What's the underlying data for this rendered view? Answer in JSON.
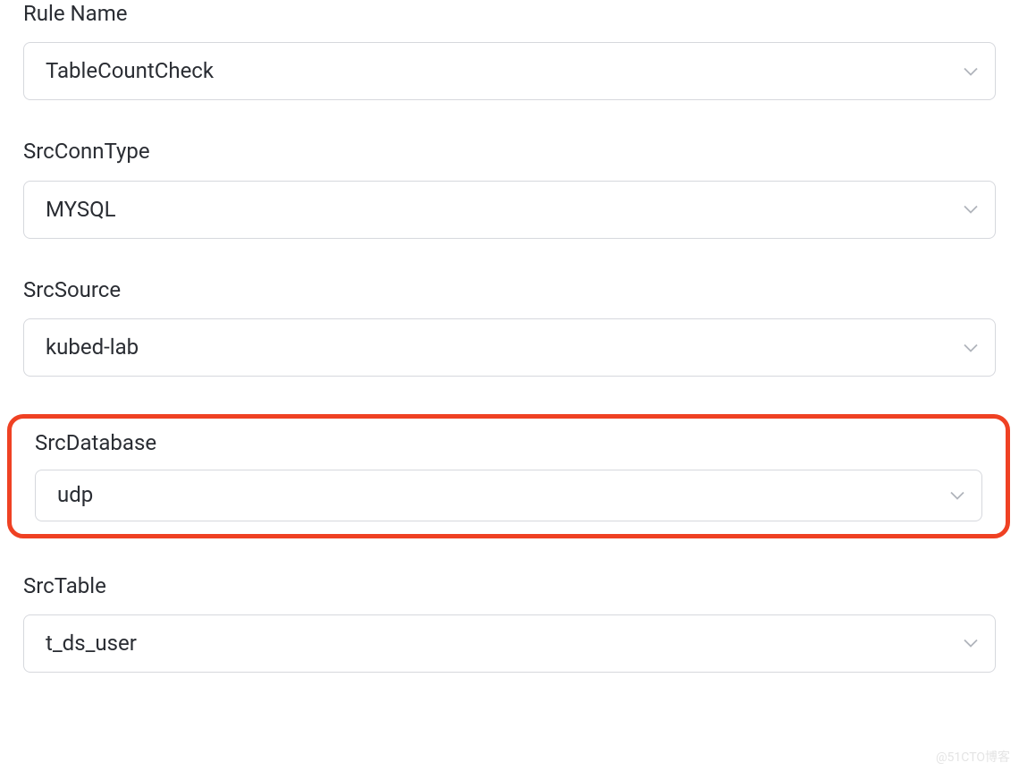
{
  "fields": {
    "ruleName": {
      "label": "Rule Name",
      "value": "TableCountCheck"
    },
    "srcConnType": {
      "label": "SrcConnType",
      "value": "MYSQL"
    },
    "srcSource": {
      "label": "SrcSource",
      "value": "kubed-lab"
    },
    "srcDatabase": {
      "label": "SrcDatabase",
      "value": "udp"
    },
    "srcTable": {
      "label": "SrcTable",
      "value": "t_ds_user"
    }
  },
  "watermark": "@51CTO博客"
}
